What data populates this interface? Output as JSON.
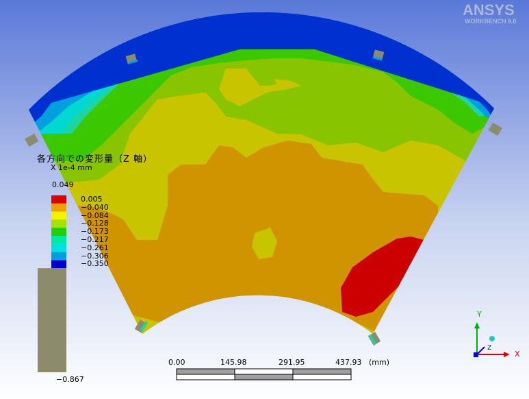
{
  "brand": {
    "name": "ANSYS",
    "subtitle": "WORKBENCH 9.0"
  },
  "legend": {
    "title": "各方向での変形量（Z 軸）",
    "unit": "X 1e-4 mm",
    "max": "0.049",
    "bands": [
      {
        "value": "0.005",
        "color": "#e00000"
      },
      {
        "value": "−0.040",
        "color": "#f0a000"
      },
      {
        "value": "−0.084",
        "color": "#f4f400"
      },
      {
        "value": "−0.128",
        "color": "#a8e000"
      },
      {
        "value": "−0.173",
        "color": "#20d000"
      },
      {
        "value": "−0.217",
        "color": "#00e8a0"
      },
      {
        "value": "−0.261",
        "color": "#00e0e0"
      },
      {
        "value": "−0.306",
        "color": "#00a0e0"
      },
      {
        "value": "−0.350",
        "color": "#0000d0"
      }
    ],
    "min": "−0.867",
    "out_of_range_color": "#8c8c6c"
  },
  "scale": {
    "ticks": [
      "0.00",
      "145.98",
      "291.95",
      "437.93"
    ],
    "unit": "(mm)"
  },
  "triad": {
    "x": "X",
    "y": "Y",
    "z": "Z"
  },
  "colors": {
    "bg_top": "#5a78d8",
    "bg_bottom": "#ffffff"
  }
}
